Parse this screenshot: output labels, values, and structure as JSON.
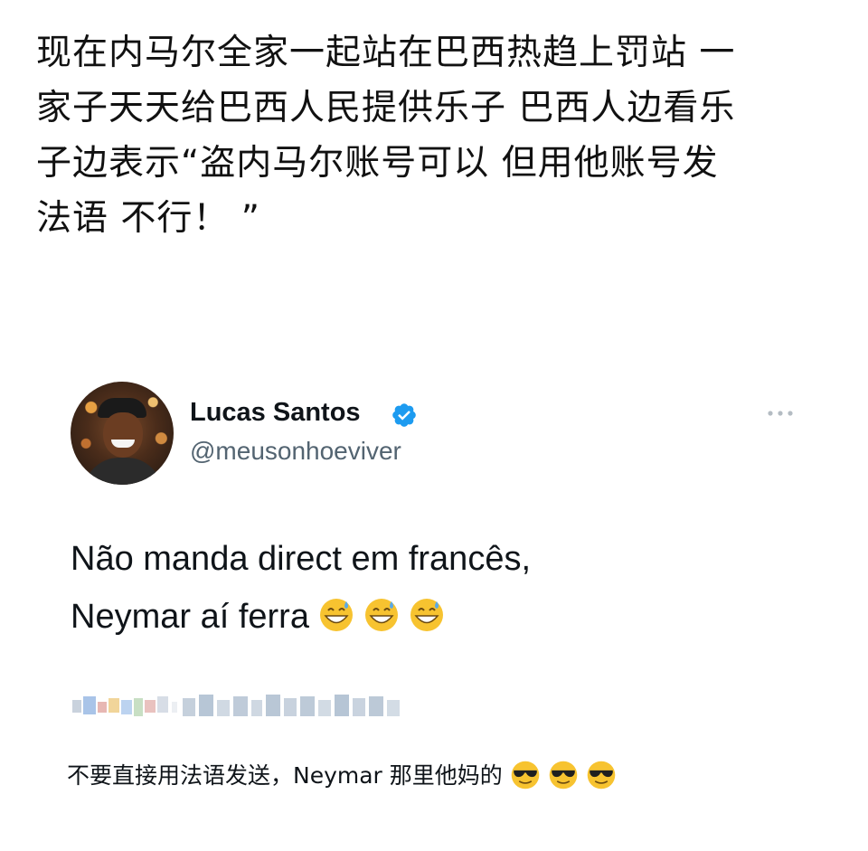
{
  "post": {
    "lines": [
      "现在内马尔全家一起站在巴西热趋上罚站 一",
      "家子天天给巴西人民提供乐子 巴西人边看乐",
      "子边表示“盗内马尔账号可以 但用他账号发",
      "法语 不行！ ”"
    ]
  },
  "tweet": {
    "display_name": "Lucas Santos",
    "handle": "@meusonhoeviver",
    "verified": true,
    "body_lines": [
      "Não manda direct em francês,",
      "Neymar aí ferra"
    ],
    "body_emoji": [
      "grinning-sweat-emoji",
      "grinning-sweat-emoji",
      "grinning-sweat-emoji"
    ],
    "translation_text": "不要直接用法语发送，Neymar 那里他妈的",
    "translation_emoji": [
      "sunglasses-emoji",
      "sunglasses-emoji",
      "sunglasses-emoji"
    ]
  },
  "colors": {
    "text": "#0f1419",
    "handle": "#536471",
    "verified": "#1d9bf0",
    "emoji_face": "#f7c330"
  },
  "icons": {
    "verified": "verified-badge-icon",
    "more": "more-horizontal-icon"
  }
}
